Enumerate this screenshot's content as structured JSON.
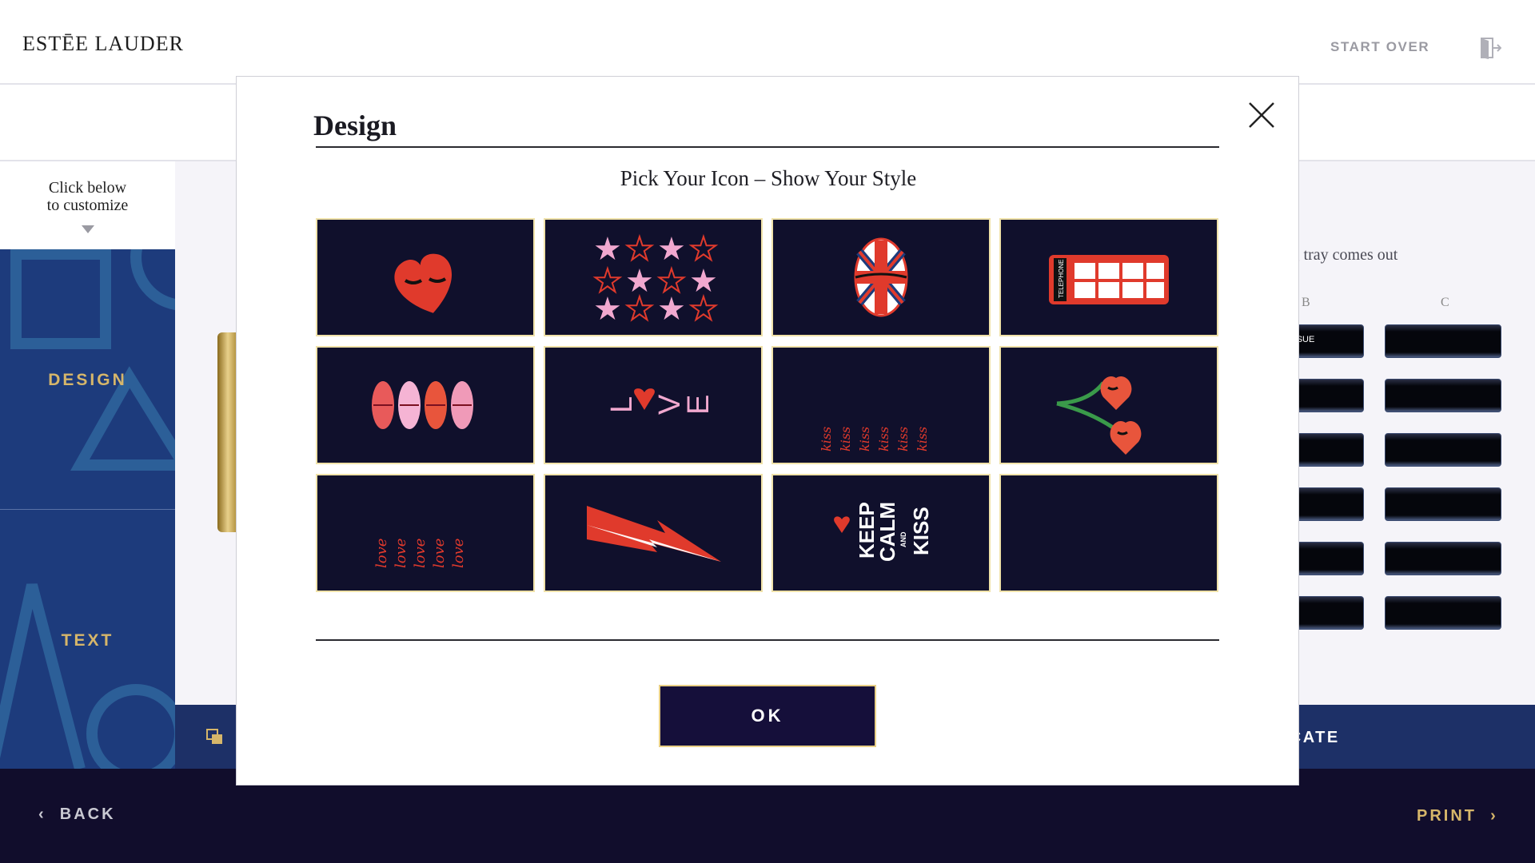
{
  "header": {
    "logo": "ESTĒE LAUDER",
    "start_over": "START OVER",
    "exit_icon": "exit-door-icon"
  },
  "sidebar": {
    "hint": "Click below\nto customize",
    "tabs": [
      {
        "label": "DESIGN"
      },
      {
        "label": "TEXT"
      }
    ]
  },
  "right_panel": {
    "hint": "ing tray comes out",
    "columns": [
      "B",
      "C"
    ],
    "slot_text": "SUE"
  },
  "action_bar": {
    "duplicate_label": "LICATE",
    "copy_icon": "copy-icon"
  },
  "footer": {
    "back_label": "BACK",
    "print_label": "PRINT"
  },
  "modal": {
    "title": "Design",
    "subtitle": "Pick Your Icon – Show Your Style",
    "ok_label": "OK",
    "icons": [
      {
        "name": "heart-with-lashes"
      },
      {
        "name": "stars-pattern"
      },
      {
        "name": "union-jack-lips"
      },
      {
        "name": "telephone-box",
        "text": "TELEPHONE"
      },
      {
        "name": "lips-row"
      },
      {
        "name": "love-letters",
        "text": [
          "L",
          "V",
          "E"
        ]
      },
      {
        "name": "kiss-script",
        "text": "kiss"
      },
      {
        "name": "heart-cherries"
      },
      {
        "name": "love-script",
        "text": "love"
      },
      {
        "name": "lightning-bolt"
      },
      {
        "name": "keep-calm-and-kiss",
        "text": [
          "KEEP",
          "CALM",
          "AND",
          "KISS"
        ]
      },
      {
        "name": "empty"
      }
    ]
  },
  "colors": {
    "navy": "#10102c",
    "gold": "#d6b66a",
    "tile_border": "#f0e2a9",
    "red": "#e03a2c",
    "pink": "#f1a8cf",
    "sidebar_blue": "#1d3b7c"
  }
}
